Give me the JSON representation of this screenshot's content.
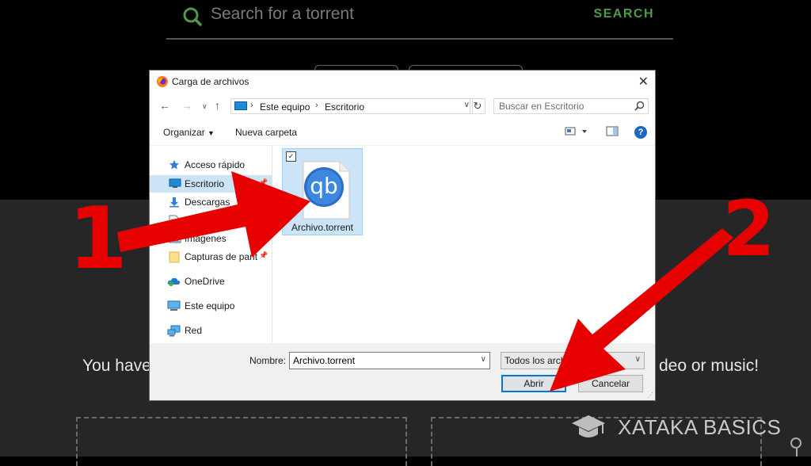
{
  "background": {
    "search_placeholder": "Search for a torrent",
    "search_button": "SEARCH",
    "message_left": "You have",
    "message_right": "deo or music!"
  },
  "dialog": {
    "title": "Carga de archivos",
    "address": [
      "Este equipo",
      "Escritorio"
    ],
    "search_placeholder": "Buscar en Escritorio",
    "toolbar": {
      "organize": "Organizar",
      "new_folder": "Nueva carpeta",
      "help": "?"
    },
    "nav": [
      {
        "label": "Acceso rápido",
        "icon": "star-icon"
      },
      {
        "label": "Escritorio",
        "icon": "desktop-icon",
        "selected": true,
        "pinned": true
      },
      {
        "label": "Descargas",
        "icon": "download-icon",
        "pinned": true
      },
      {
        "label": "Documentos",
        "icon": "document-icon",
        "pinned": true
      },
      {
        "label": "Imágenes",
        "icon": "image-icon",
        "pinned": true
      },
      {
        "label": "Capturas de pantalla",
        "icon": "folder-icon",
        "pinned": true
      },
      {
        "label": "OneDrive",
        "icon": "cloud-icon"
      },
      {
        "label": "Este equipo",
        "icon": "computer-icon"
      },
      {
        "label": "Red",
        "icon": "network-icon"
      }
    ],
    "file": {
      "name": "Archivo.torrent",
      "icon_text": "qb"
    },
    "filename_label": "Nombre:",
    "filename_value": "Archivo.torrent",
    "filetype": "Todos los archivos",
    "open_button": "Abrir",
    "cancel_button": "Cancelar"
  },
  "annotations": {
    "arrow1": "1",
    "arrow2": "2"
  },
  "watermark": {
    "text": "XATAKA BASICS"
  },
  "colors": {
    "accent_green": "#4f9a48",
    "arrow_red": "#e60000",
    "selection_blue": "#cce4f7",
    "primary_border": "#0078d7"
  }
}
